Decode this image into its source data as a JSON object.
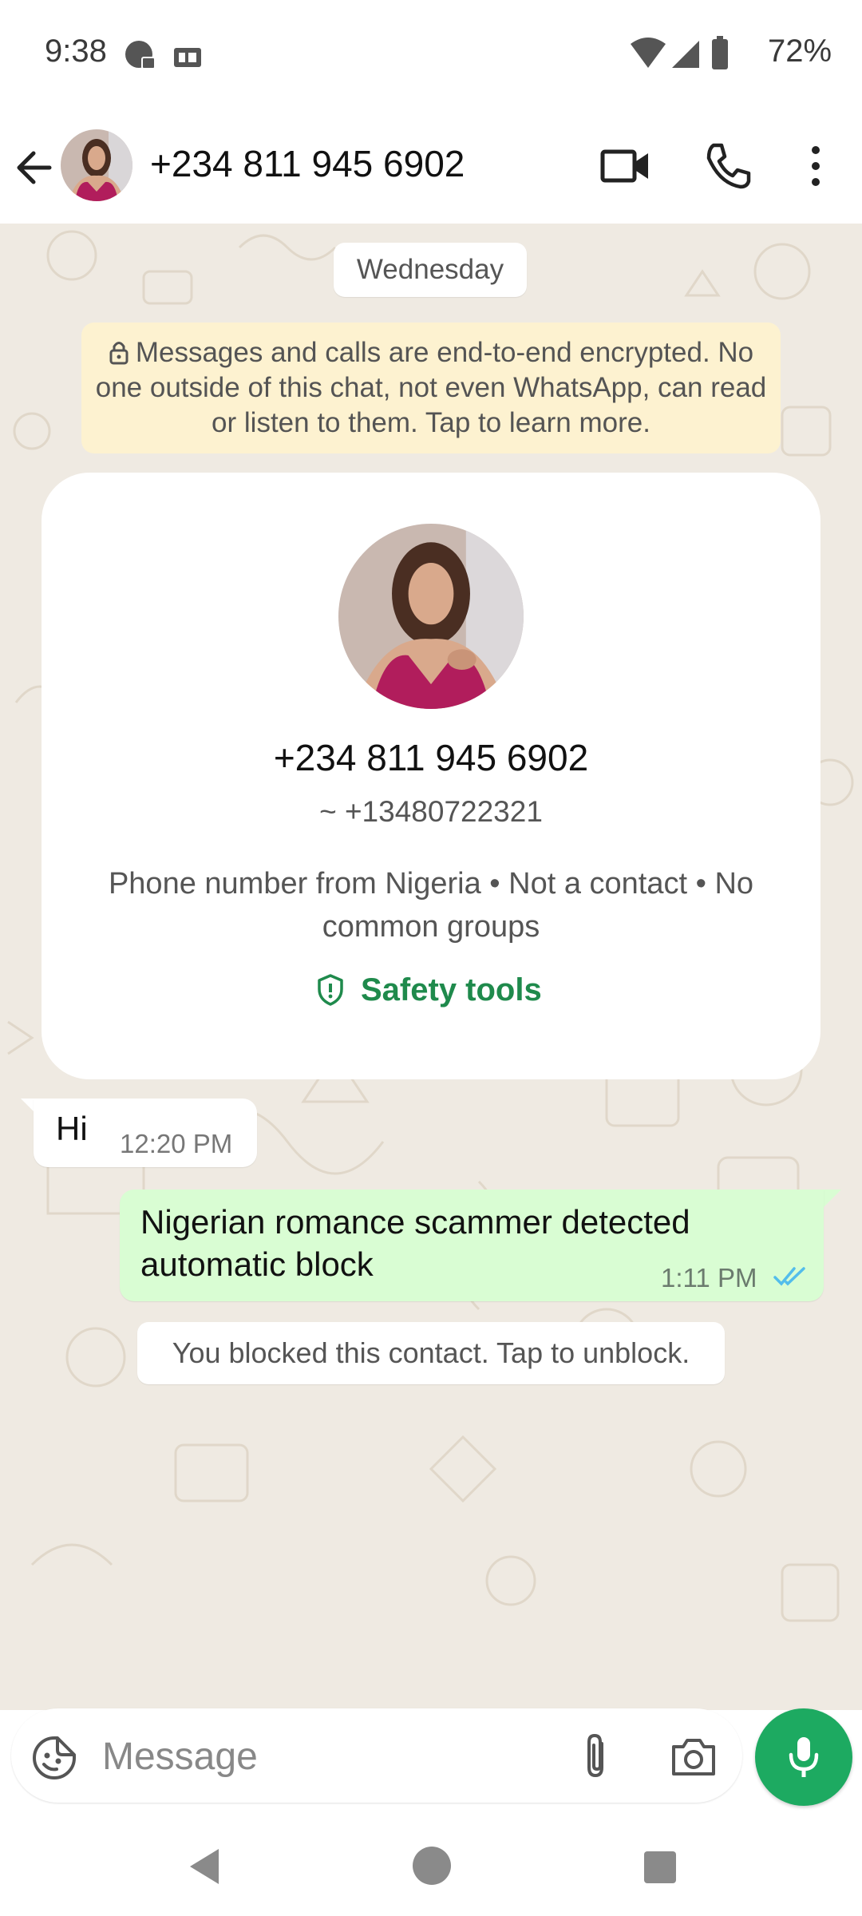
{
  "status_bar": {
    "time": "9:38",
    "battery": "72%",
    "icons": [
      "chat-notification-icon",
      "media-notification-icon",
      "wifi-icon",
      "signal-icon",
      "battery-icon"
    ]
  },
  "header": {
    "title": "+234 811 945 6902",
    "icons": [
      "back-arrow-icon",
      "video-call-icon",
      "voice-call-icon",
      "more-vert-icon"
    ]
  },
  "chat": {
    "date_chip": "Wednesday",
    "encryption_notice": "Messages and calls are end-to-end encrypted. No one outside of this chat, not even WhatsApp, can read or listen to them. Tap to learn more.",
    "profile_card": {
      "phone": "+234 811 945 6902",
      "alias": "~ +13480722321",
      "info": "Phone number from Nigeria • Not a contact • No common groups",
      "safety_tools_label": "Safety tools"
    },
    "messages": [
      {
        "direction": "incoming",
        "text": "Hi",
        "time": "12:20 PM"
      },
      {
        "direction": "outgoing",
        "text": "Nigerian romance scammer detected automatic block",
        "time": "1:11 PM",
        "status": "read"
      }
    ],
    "system_message": "You blocked this contact. Tap to unblock."
  },
  "composer": {
    "placeholder": "Message",
    "icons": [
      "sticker-icon",
      "attach-icon",
      "camera-icon",
      "mic-icon"
    ]
  },
  "colors": {
    "chat_background": "#efeae2",
    "outgoing_bubble": "#d9fdd3",
    "encryption_banner": "#fdf2d0",
    "accent_green": "#1daa61",
    "safety_green": "#1f8a4c",
    "read_ticks": "#53bdeb"
  }
}
